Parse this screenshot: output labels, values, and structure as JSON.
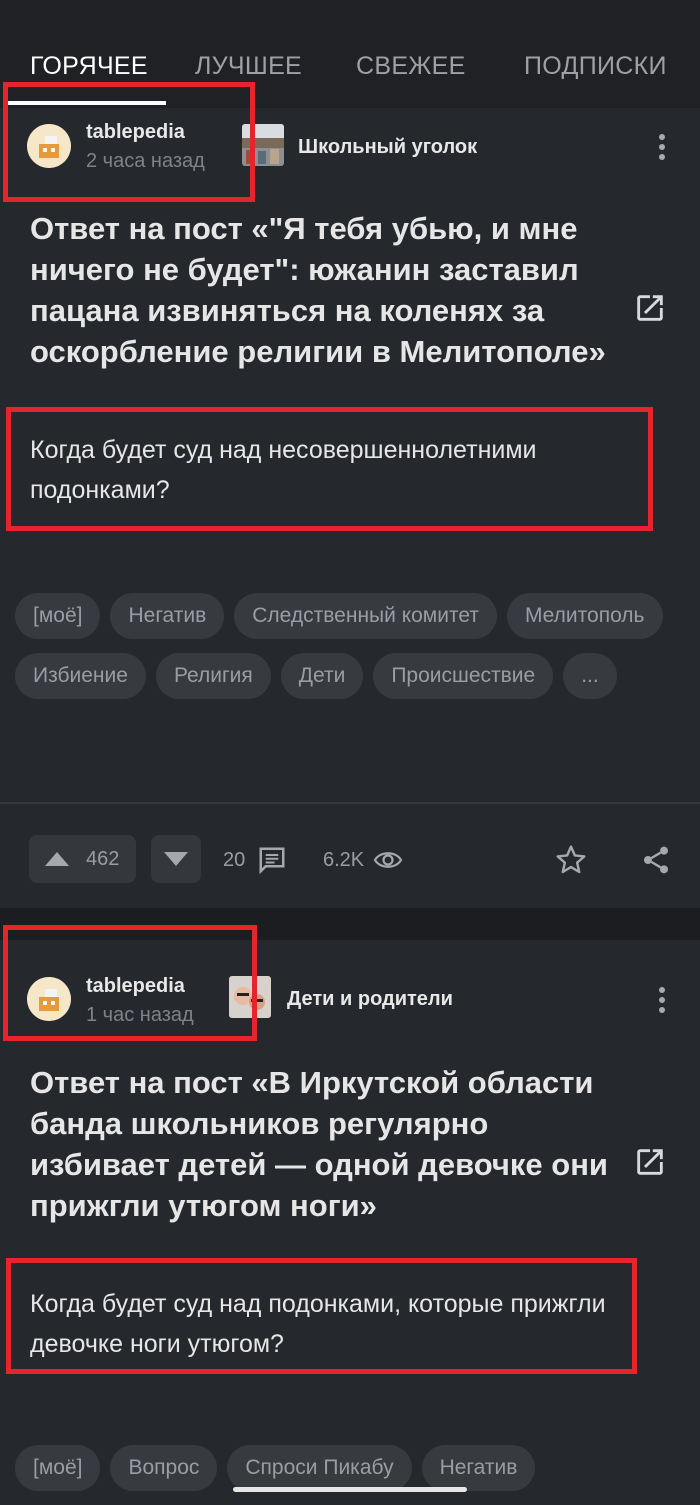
{
  "tabs": [
    {
      "label": "ГОРЯЧЕЕ",
      "active": true
    },
    {
      "label": "ЛУЧШЕЕ"
    },
    {
      "label": "СВЕЖЕЕ"
    },
    {
      "label": "ПОДПИСКИ"
    }
  ],
  "posts": [
    {
      "author": "tablepedia",
      "time": "2 часа назад",
      "community": "Школьный уголок",
      "title": "Ответ на пост «\"Я тебя убью, и мне ничего не будет\": южанин заставил пацана извиняться на коленях за оскорбление религии в Мелитополе»",
      "text": "Когда будет суд над несовершеннолетними подонками?",
      "tags": [
        "[моё]",
        "Негатив",
        "Следственный комитет",
        "Мелитополь",
        "Избиение",
        "Религия",
        "Дети",
        "Происшествие",
        "..."
      ],
      "rating": "462",
      "comments": "20",
      "views": "6.2K"
    },
    {
      "author": "tablepedia",
      "time": "1 час назад",
      "community": "Дети и родители",
      "title": "Ответ на пост «В Иркутской области банда школьников регулярно избивает детей — одной девочке они прижгли утюгом ноги»",
      "text": "Когда будет суд над подонками, которые прижгли девочке ноги утюгом?",
      "tags": [
        "[моё]",
        "Вопрос",
        "Спроси Пикабу",
        "Негатив"
      ]
    }
  ],
  "colors": {
    "background": "#25282c",
    "highlight": "#e5242d",
    "tag_bg": "#373a3f"
  }
}
